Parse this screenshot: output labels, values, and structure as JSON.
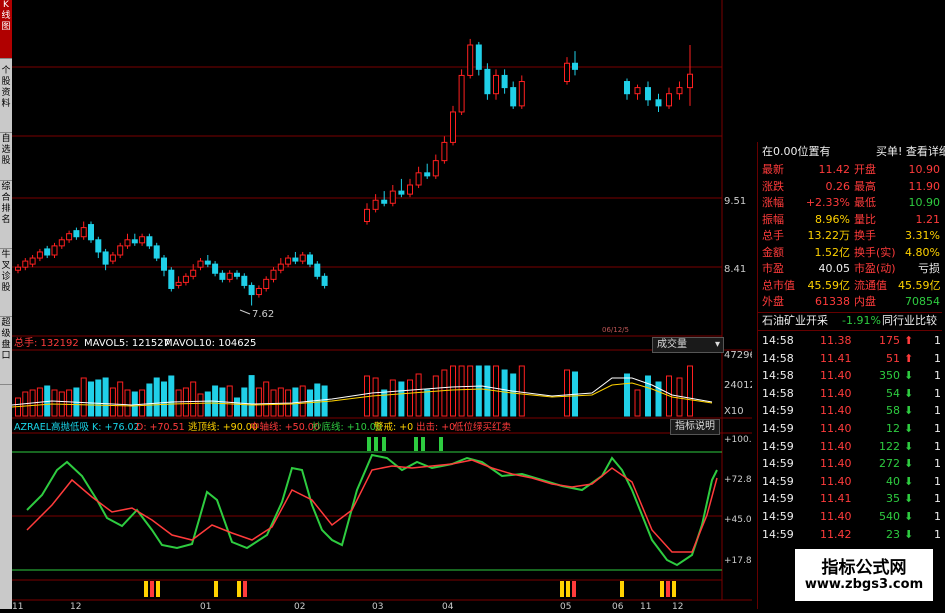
{
  "sidebar": {
    "tabs": [
      {
        "label": "K线图",
        "active": true
      },
      {
        "label": "个股资料",
        "active": false
      },
      {
        "label": "自选股",
        "active": false
      },
      {
        "label": "综合排名",
        "active": false
      },
      {
        "label": "牛叉诊股",
        "active": false
      },
      {
        "label": "超级盘口",
        "active": false
      }
    ]
  },
  "price_pane": {
    "y_labels": [
      "9.51",
      "8.41"
    ],
    "low_label": "7.62",
    "small_tag": "06/12/5"
  },
  "volume_pane": {
    "header": [
      {
        "text": "总手: 132192",
        "color": "#ff3b3b"
      },
      {
        "text": "MAVOL5: 121527",
        "color": "#ffffff"
      },
      {
        "text": "MAVOL10: 104625",
        "color": "#ffffff"
      }
    ],
    "selector": "成交量",
    "y_labels": [
      "47296",
      "24012",
      "X10"
    ]
  },
  "indicator_pane": {
    "header": [
      {
        "text": "AZRAEL高抛低吸 K: +76.02",
        "color": "#19d5e8"
      },
      {
        "text": "D: +70.51",
        "color": "#ff3b3b"
      },
      {
        "text": "逃顶线: +90.00",
        "color": "#ffd200"
      },
      {
        "text": "中轴线: +50.00",
        "color": "#ff3b3b"
      },
      {
        "text": "抄底线: +10.00",
        "color": "#2ecc40"
      },
      {
        "text": "警戒: +0",
        "color": "#ffd200"
      },
      {
        "text": "出击: +0",
        "color": "#ff3b3b"
      },
      {
        "text": "低位绿买红卖",
        "color": "#ff3b3b"
      }
    ],
    "button": "指标说明",
    "y_labels": [
      "+100.0",
      "+72.82",
      "+45.00",
      "+17.8"
    ]
  },
  "x_axis_labels": [
    "11",
    "12",
    "01",
    "02",
    "03",
    "04",
    "05",
    "06",
    "11",
    "12"
  ],
  "quote_panel": {
    "header": "在0.00位置有",
    "header_right": "买单! 查看详细",
    "rows": [
      {
        "l": "最新",
        "lv": "11.42",
        "lvc": "#ff3b3b",
        "r": "开盘",
        "rv": "10.90",
        "rvc": "#ff3b3b"
      },
      {
        "l": "涨跌",
        "lv": "0.26",
        "lvc": "#ff3b3b",
        "r": "最高",
        "rv": "11.90",
        "rvc": "#ff3b3b"
      },
      {
        "l": "涨幅",
        "lv": "+2.33%",
        "lvc": "#ff3b3b",
        "r": "最低",
        "rv": "10.90",
        "rvc": "#2ecc40"
      },
      {
        "l": "振幅",
        "lv": "8.96%",
        "lvc": "#ffd200",
        "r": "量比",
        "rv": "1.21",
        "rvc": "#ff3b3b"
      },
      {
        "l": "总手",
        "lv": "13.22万",
        "lvc": "#ffd200",
        "r": "换手",
        "rv": "3.31%",
        "rvc": "#ffd200"
      },
      {
        "l": "金额",
        "lv": "1.52亿",
        "lvc": "#ffd200",
        "r": "换手(实)",
        "rv": "4.80%",
        "rvc": "#ffd200"
      },
      {
        "l": "市盈",
        "lv": "40.05",
        "lvc": "#eeeeee",
        "r": "市盈(动)",
        "rv": "亏损",
        "rvc": "#eeeeee"
      },
      {
        "l": "总市值",
        "lv": "45.59亿",
        "lvc": "#ffd200",
        "r": "流通值",
        "rv": "45.59亿",
        "rvc": "#ffd200"
      },
      {
        "l": "外盘",
        "lv": "61338",
        "lvc": "#ff3b3b",
        "r": "内盘",
        "rv": "70854",
        "rvc": "#2ecc40"
      }
    ],
    "sector": "石油矿业开采",
    "sector_change": "-1.91%",
    "sector_button": "同行业比较",
    "ticks": [
      {
        "t": "14:58",
        "p": "11.38",
        "v": "175",
        "dir": "up"
      },
      {
        "t": "14:58",
        "p": "11.41",
        "v": "51",
        "dir": "up"
      },
      {
        "t": "14:58",
        "p": "11.40",
        "v": "350",
        "dir": "down"
      },
      {
        "t": "14:58",
        "p": "11.40",
        "v": "54",
        "dir": "down"
      },
      {
        "t": "14:59",
        "p": "11.40",
        "v": "58",
        "dir": "down"
      },
      {
        "t": "14:59",
        "p": "11.40",
        "v": "12",
        "dir": "down"
      },
      {
        "t": "14:59",
        "p": "11.40",
        "v": "122",
        "dir": "down"
      },
      {
        "t": "14:59",
        "p": "11.40",
        "v": "272",
        "dir": "down"
      },
      {
        "t": "14:59",
        "p": "11.40",
        "v": "40",
        "dir": "down"
      },
      {
        "t": "14:59",
        "p": "11.41",
        "v": "35",
        "dir": "down"
      },
      {
        "t": "14:59",
        "p": "11.40",
        "v": "540",
        "dir": "down"
      },
      {
        "t": "14:59",
        "p": "11.42",
        "v": "23",
        "dir": "down"
      }
    ],
    "tick_right": "1"
  },
  "watermark": {
    "line1": "指标公式网",
    "line2": "www.zbgs3.com"
  },
  "colors": {
    "up": "#ff2020",
    "down": "#20d0e8",
    "grid": "#7a0000"
  },
  "chart_data": {
    "type": "candlestick",
    "price_range": [
      7.3,
      11.9
    ],
    "candles": [
      [
        8.2,
        8.25,
        8.3,
        8.15
      ],
      [
        8.25,
        8.35,
        8.4,
        8.2
      ],
      [
        8.3,
        8.4,
        8.45,
        8.25
      ],
      [
        8.4,
        8.5,
        8.55,
        8.35
      ],
      [
        8.55,
        8.45,
        8.6,
        8.4
      ],
      [
        8.45,
        8.6,
        8.65,
        8.4
      ],
      [
        8.6,
        8.7,
        8.75,
        8.55
      ],
      [
        8.7,
        8.8,
        8.85,
        8.65
      ],
      [
        8.85,
        8.75,
        8.9,
        8.7
      ],
      [
        8.75,
        8.9,
        9.0,
        8.7
      ],
      [
        8.95,
        8.7,
        9.0,
        8.65
      ],
      [
        8.7,
        8.5,
        8.75,
        8.4
      ],
      [
        8.5,
        8.3,
        8.55,
        8.2
      ],
      [
        8.35,
        8.45,
        8.5,
        8.3
      ],
      [
        8.45,
        8.6,
        8.65,
        8.4
      ],
      [
        8.6,
        8.7,
        8.8,
        8.55
      ],
      [
        8.7,
        8.65,
        8.8,
        8.6
      ],
      [
        8.65,
        8.75,
        8.8,
        8.6
      ],
      [
        8.75,
        8.6,
        8.8,
        8.55
      ],
      [
        8.6,
        8.4,
        8.65,
        8.35
      ],
      [
        8.4,
        8.2,
        8.45,
        8.1
      ],
      [
        8.2,
        7.9,
        8.25,
        7.85
      ],
      [
        7.95,
        8.0,
        8.1,
        7.9
      ],
      [
        8.0,
        8.1,
        8.15,
        7.95
      ],
      [
        8.1,
        8.2,
        8.3,
        8.05
      ],
      [
        8.25,
        8.35,
        8.4,
        8.2
      ],
      [
        8.35,
        8.3,
        8.45,
        8.25
      ],
      [
        8.3,
        8.15,
        8.35,
        8.1
      ],
      [
        8.15,
        8.05,
        8.2,
        8.0
      ],
      [
        8.05,
        8.15,
        8.2,
        8.0
      ],
      [
        8.15,
        8.1,
        8.2,
        8.05
      ],
      [
        8.1,
        7.95,
        8.15,
        7.9
      ],
      [
        7.95,
        7.8,
        8.0,
        7.62
      ],
      [
        7.8,
        7.9,
        7.95,
        7.75
      ],
      [
        7.9,
        8.05,
        8.1,
        7.85
      ],
      [
        8.05,
        8.2,
        8.25,
        8.0
      ],
      [
        8.2,
        8.3,
        8.4,
        8.15
      ],
      [
        8.3,
        8.4,
        8.45,
        8.25
      ],
      [
        8.4,
        8.35,
        8.5,
        8.3
      ],
      [
        8.35,
        8.45,
        8.5,
        8.3
      ],
      [
        8.45,
        8.3,
        8.5,
        8.25
      ],
      [
        8.3,
        8.1,
        8.35,
        8.05
      ],
      [
        8.1,
        7.95,
        8.15,
        7.9
      ],
      [
        9.0,
        9.2,
        9.3,
        8.95
      ],
      [
        9.2,
        9.35,
        9.45,
        9.15
      ],
      [
        9.35,
        9.3,
        9.5,
        9.25
      ],
      [
        9.3,
        9.5,
        9.6,
        9.25
      ],
      [
        9.5,
        9.45,
        9.7,
        9.4
      ],
      [
        9.45,
        9.6,
        9.7,
        9.4
      ],
      [
        9.6,
        9.8,
        9.9,
        9.55
      ],
      [
        9.8,
        9.75,
        9.95,
        9.7
      ],
      [
        9.75,
        10.0,
        10.1,
        9.7
      ],
      [
        10.0,
        10.3,
        10.4,
        9.95
      ],
      [
        10.3,
        10.8,
        10.9,
        10.25
      ],
      [
        10.8,
        11.4,
        11.5,
        10.75
      ],
      [
        11.4,
        11.9,
        12.0,
        11.35
      ],
      [
        11.9,
        11.5,
        11.95,
        11.4
      ],
      [
        11.5,
        11.1,
        11.6,
        11.0
      ],
      [
        11.1,
        11.4,
        11.5,
        11.0
      ],
      [
        11.4,
        11.2,
        11.5,
        11.1
      ],
      [
        11.2,
        10.9,
        11.3,
        10.85
      ],
      [
        10.9,
        11.3,
        11.4,
        10.85
      ],
      [
        11.3,
        11.6,
        11.7,
        11.25
      ],
      [
        11.6,
        11.5,
        11.8,
        11.4
      ],
      [
        11.3,
        11.1,
        11.35,
        11.0
      ],
      [
        11.1,
        11.2,
        11.25,
        11.0
      ],
      [
        11.2,
        11.0,
        11.3,
        10.9
      ],
      [
        11.0,
        10.9,
        11.1,
        10.8
      ],
      [
        10.9,
        11.1,
        11.2,
        10.85
      ],
      [
        11.1,
        11.2,
        11.3,
        11.0
      ],
      [
        11.2,
        11.42,
        11.9,
        10.9
      ]
    ],
    "price_series_note": "OHLC [open, close, high, low] per session, read approximately from the chart",
    "volume_max": 47296
  }
}
